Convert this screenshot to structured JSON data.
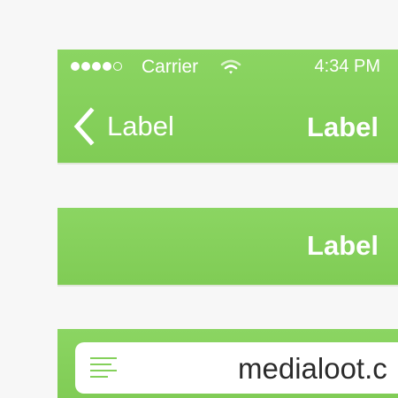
{
  "status_bar": {
    "signal_bars": 4,
    "signal_total": 5,
    "carrier": "Carrier",
    "wifi_icon": "wifi-icon",
    "time": "4:34 PM"
  },
  "nav_bar_1": {
    "back_icon": "chevron-left-icon",
    "back_label": "Label",
    "title": "Label"
  },
  "nav_bar_2": {
    "title": "Label"
  },
  "url_bar": {
    "menu_icon": "menu-lines-icon",
    "url": "medialoot.c"
  },
  "colors": {
    "accent": "#84d05a",
    "text_light": "#ffffff",
    "background": "#f7f7f7"
  }
}
